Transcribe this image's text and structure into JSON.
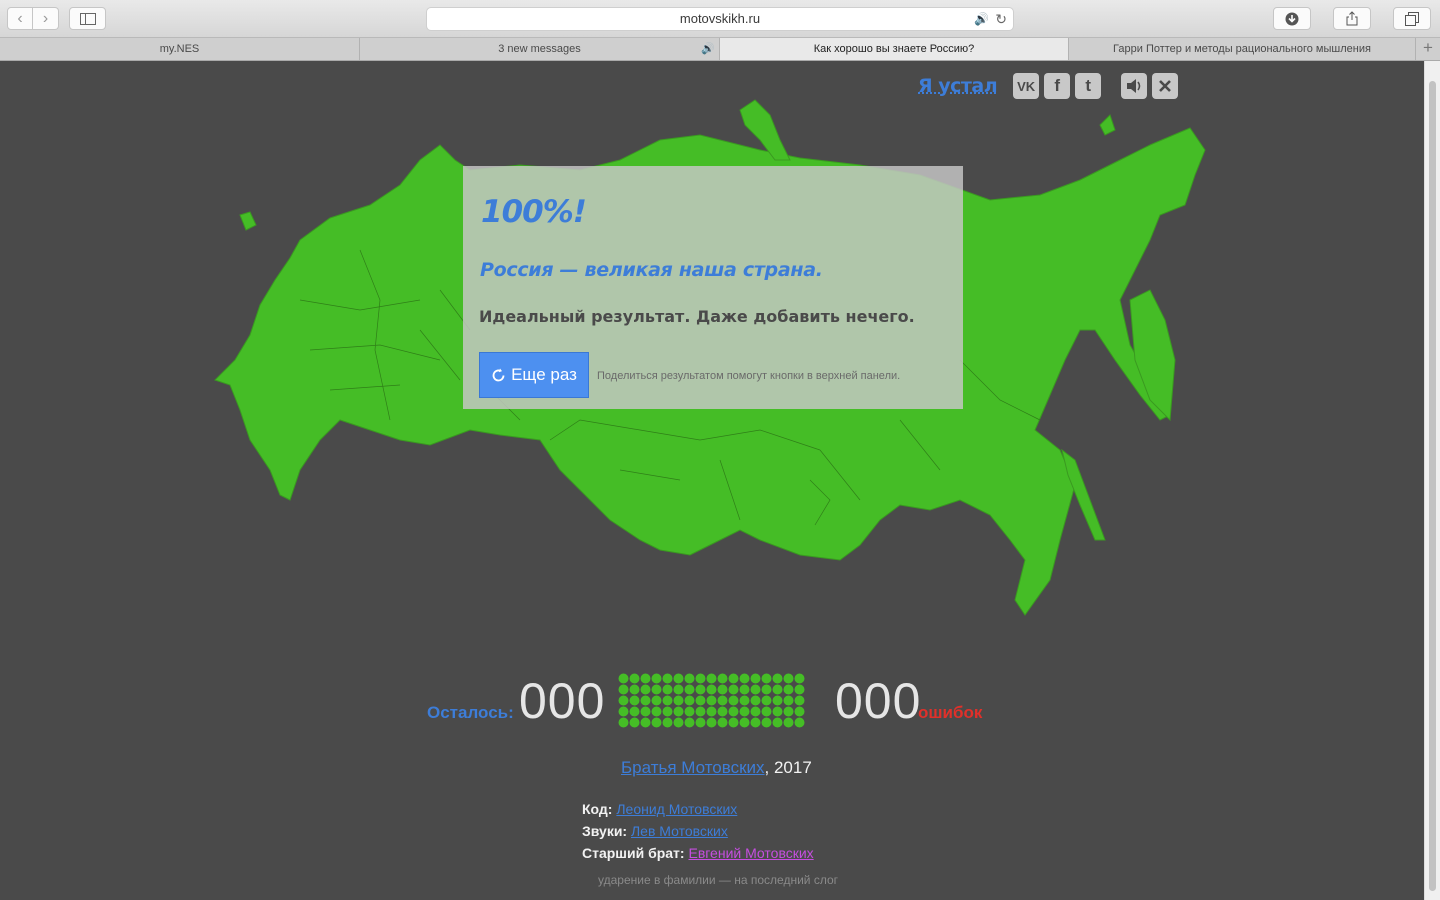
{
  "browser": {
    "url": "motovskikh.ru",
    "tabs": [
      {
        "title": "my.NES",
        "active": false,
        "audio": false
      },
      {
        "title": "3 new messages",
        "active": false,
        "audio": true
      },
      {
        "title": "Как хорошо вы знаете Россию?",
        "active": true,
        "audio": false
      },
      {
        "title": "Гарри Поттер и методы рационального мышления",
        "active": false,
        "audio": false
      }
    ],
    "new_tab": "+"
  },
  "top_bar": {
    "tired_link": "Я устал",
    "social": {
      "vk": "VK",
      "facebook": "f",
      "twitter": "t"
    },
    "icons": [
      "vk-icon",
      "facebook-icon",
      "twitter-icon",
      "speaker-icon",
      "close-icon"
    ]
  },
  "dialog": {
    "score": "100%!",
    "slogan": "Россия — великая наша страна.",
    "message": "Идеальный результат. Даже добавить нечего.",
    "retry_button": "Еще раз",
    "hint": "Поделиться результатом помогут кнопки в верхней панели."
  },
  "counters": {
    "remaining_label": "Осталось:",
    "remaining": "000",
    "errors": "000",
    "errors_label": "ошибок",
    "dots_filled": 85,
    "dots_total": 85
  },
  "footer": {
    "brothers_link": "Братья Мотовских",
    "year": ", 2017",
    "code_label": "Код:",
    "code_name": "Леонид Мотовских",
    "sounds_label": "Звуки:",
    "sounds_name": "Лев Мотовских",
    "elder_label": "Старший брат:",
    "elder_name": "Евгений Мотовских",
    "stress_note": "ударение в фамилии — на последний слог"
  },
  "colors": {
    "map_green": "#45bd26",
    "background": "#4a4a4a",
    "accent_blue": "#3d7dd8",
    "error_red": "#e0302a"
  }
}
